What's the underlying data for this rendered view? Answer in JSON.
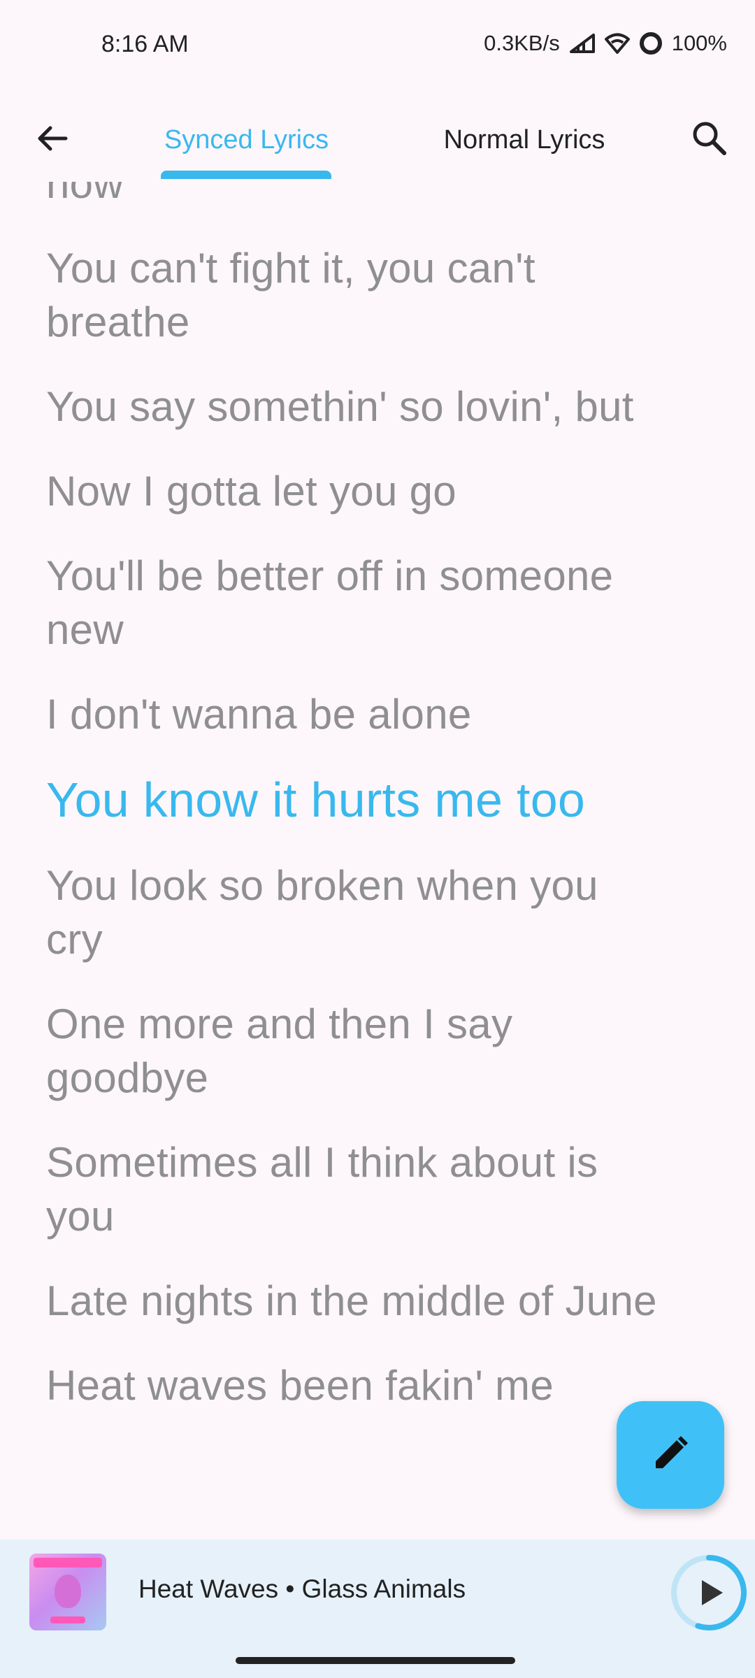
{
  "status_bar": {
    "time": "8:16 AM",
    "net_speed": "0.3KB/s",
    "battery": "100%"
  },
  "tabs": [
    {
      "label": "Synced Lyrics",
      "selected": true
    },
    {
      "label": "Normal Lyrics",
      "selected": false
    }
  ],
  "lyrics": [
    {
      "text": "now",
      "active": false
    },
    {
      "text": "You can't fight it, you can't breathe",
      "active": false
    },
    {
      "text": "You say somethin' so lovin', but",
      "active": false
    },
    {
      "text": "Now I gotta let you go",
      "active": false
    },
    {
      "text": "You'll be better off in someone new",
      "active": false
    },
    {
      "text": "I don't wanna be alone",
      "active": false
    },
    {
      "text": "You know it hurts me too",
      "active": true
    },
    {
      "text": "You look so broken when you cry",
      "active": false
    },
    {
      "text": "One more and then I say goodbye",
      "active": false
    },
    {
      "text": "Sometimes all I think about is you",
      "active": false
    },
    {
      "text": "Late nights in the middle of June",
      "active": false
    },
    {
      "text": "Heat waves been fakin' me",
      "active": false
    }
  ],
  "player": {
    "now_playing": "Heat Waves • Glass Animals",
    "progress_fraction": 0.55,
    "accent": "#39b8ee"
  },
  "icons": {
    "back": "arrow-back-icon",
    "search": "search-icon",
    "edit": "pencil-icon",
    "play": "play-icon"
  }
}
